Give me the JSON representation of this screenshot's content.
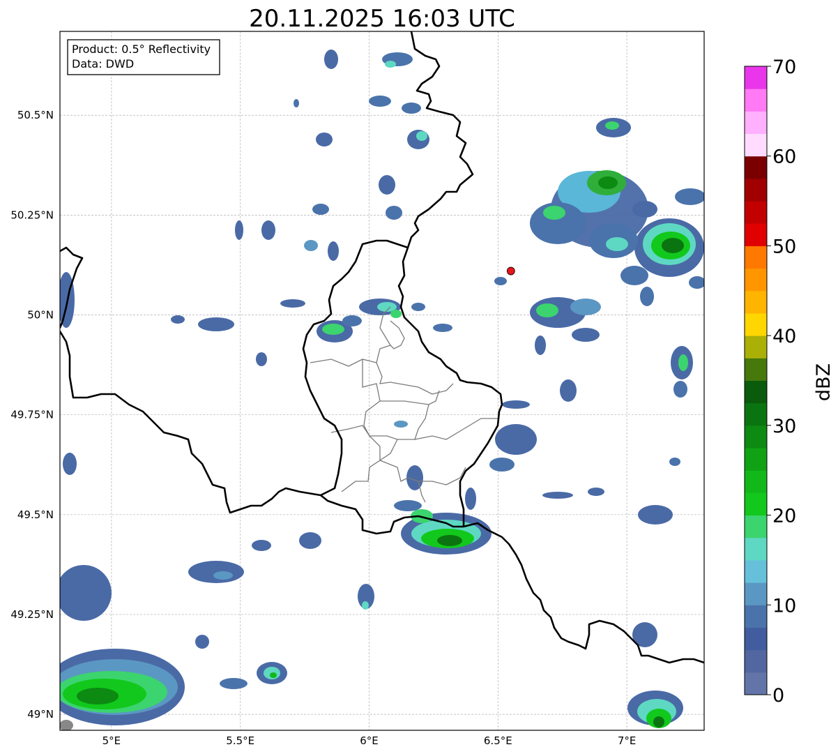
{
  "map": {
    "title": "20.11.2025 16:03 UTC",
    "info_box": {
      "product": "Product: 0.5° Reflectivity",
      "data": "Data: DWD"
    },
    "extent": {
      "lon": [
        4.8,
        7.3
      ],
      "lat": [
        48.96,
        50.71
      ]
    },
    "lon_ticks": [
      {
        "value": 5.0,
        "label": "5°E"
      },
      {
        "value": 5.5,
        "label": "5.5°E"
      },
      {
        "value": 6.0,
        "label": "6°E"
      },
      {
        "value": 6.5,
        "label": "6.5°E"
      },
      {
        "value": 7.0,
        "label": "7°E"
      }
    ],
    "lat_ticks": [
      {
        "value": 50.5,
        "label": "50.5°N"
      },
      {
        "value": 50.25,
        "label": "50.25°N"
      },
      {
        "value": 50.0,
        "label": "50°N"
      },
      {
        "value": 49.75,
        "label": "49.75°N"
      },
      {
        "value": 49.5,
        "label": "49.5°N"
      },
      {
        "value": 49.25,
        "label": "49.25°N"
      },
      {
        "value": 49.0,
        "label": "49°N"
      }
    ],
    "radar_site": {
      "lon": 6.55,
      "lat": 50.11,
      "color": "#e8141c"
    }
  },
  "colorbar": {
    "label": "dBZ",
    "range": [
      0,
      70
    ],
    "ticks": [
      "0",
      "10",
      "20",
      "30",
      "40",
      "50",
      "60",
      "70"
    ],
    "colors": [
      "#6375a8",
      "#52679f",
      "#425d9f",
      "#4a73ab",
      "#5b97c3",
      "#66c0da",
      "#5ed8c2",
      "#3cd46e",
      "#12c81c",
      "#12b81a",
      "#10a214",
      "#0c8a12",
      "#0a7510",
      "#0a5b0c",
      "#46780c",
      "#aab006",
      "#ffd600",
      "#ffb400",
      "#ff9600",
      "#ff7800",
      "#e00000",
      "#c20000",
      "#a00000",
      "#7a0000",
      "#ffdcff",
      "#ffb0ff",
      "#ff7af4",
      "#ea36ea"
    ]
  }
}
